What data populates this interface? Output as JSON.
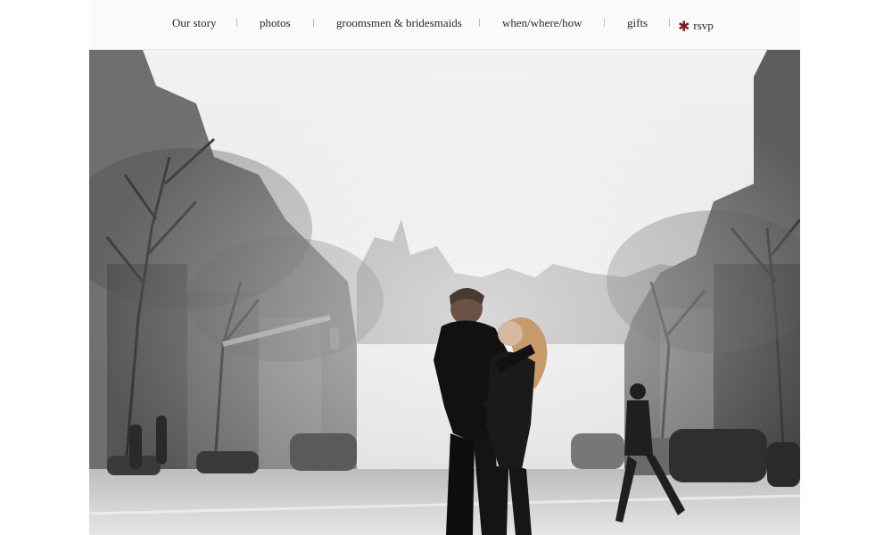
{
  "nav": {
    "items": [
      {
        "label": "Our story"
      },
      {
        "label": "photos"
      },
      {
        "label": "groomsmen & bridesmaids"
      },
      {
        "label": "when/where/how"
      },
      {
        "label": "gifts"
      },
      {
        "label": "rsvp",
        "icon": "asterisk-icon"
      }
    ],
    "accent_color": "#7a1f1f"
  },
  "photo": {
    "alt_description": "black and white street scene",
    "style": "monochrome"
  }
}
